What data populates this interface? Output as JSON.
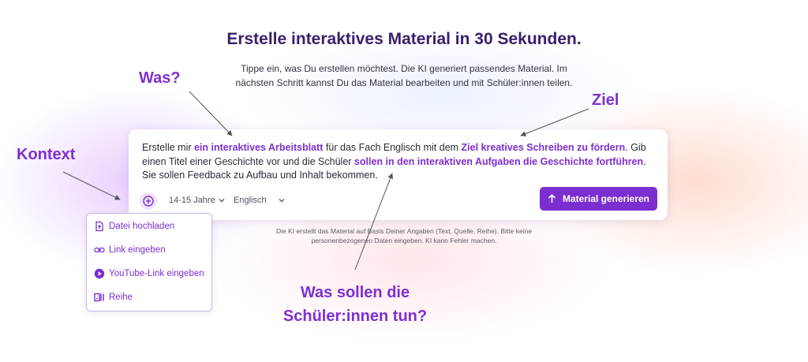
{
  "header": {
    "title": "Erstelle interaktives Material in 30 Sekunden.",
    "subtitle_line1": "Tippe ein, was Du erstellen möchtest. Die KI generiert passendes Material. Im",
    "subtitle_line2": "nächsten Schritt kannst Du das Material bearbeiten und mit Schüler:innen teilen."
  },
  "prompt": {
    "t1": "Erstelle mir ",
    "h1": "ein interaktives Arbeitsblatt",
    "t2": " für das Fach Englisch  mit dem ",
    "h2": "Ziel kreatives Schreiben zu fördern",
    "t3": ". Gib einen Titel einer Geschichte vor und die Schüler ",
    "h3": "sollen in den interaktiven Aufgaben die Geschichte fortführen",
    "t4": ". Sie sollen Feedback zu Aufbau und Inhalt bekommen."
  },
  "controls": {
    "age": "14-15 Jahre",
    "language": "Englisch",
    "generate_label": "Material generieren"
  },
  "disclaimer": {
    "line1": "Die KI erstellt das Material auf Basis Deiner Angaben (Text, Quelle, Reihe). Bitte keine",
    "line2": "personenbezogenen Daten eingeben. KI kann Fehler machen."
  },
  "menu": {
    "items": [
      {
        "label": "Datei hochladen",
        "icon": "file-upload-icon"
      },
      {
        "label": "Link eingeben",
        "icon": "link-icon"
      },
      {
        "label": "YouTube-Link eingeben",
        "icon": "play-circle-icon"
      },
      {
        "label": "Reihe",
        "icon": "series-icon"
      }
    ]
  },
  "annotations": {
    "was": "Was?",
    "ziel": "Ziel",
    "kontext": "Kontext",
    "tun_line1": "Was sollen die",
    "tun_line2": "Schüler:innen tun?"
  },
  "colors": {
    "accent": "#7b2fd0",
    "annotation": "#7e2fd1",
    "title": "#3a1f6b"
  }
}
